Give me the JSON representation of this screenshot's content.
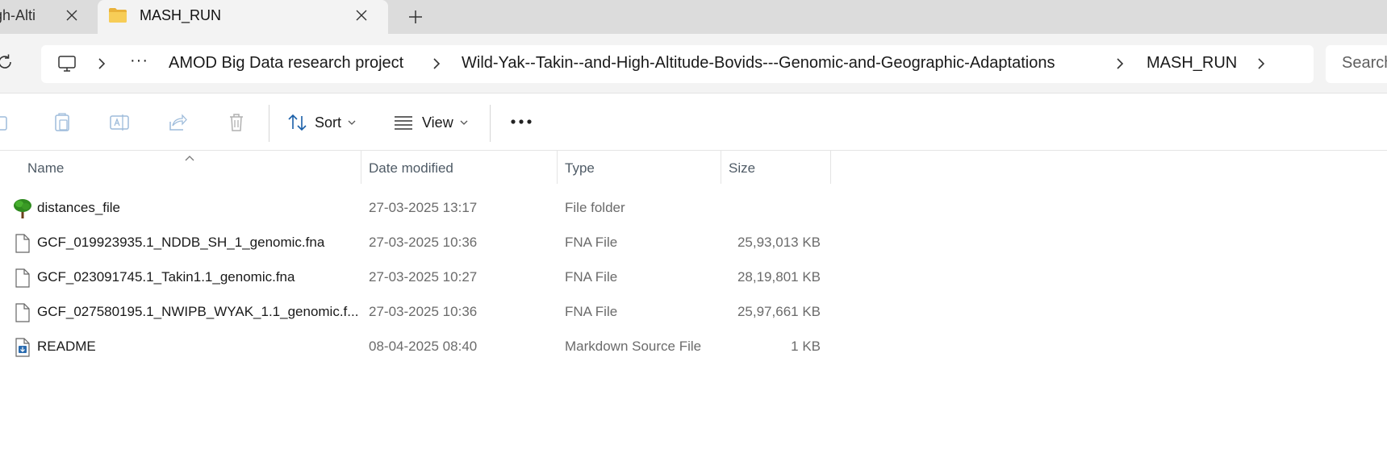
{
  "tabs": [
    {
      "title": "High-Altitude",
      "visible_text": "igh-Alti"
    },
    {
      "title": "MASH_RUN"
    }
  ],
  "breadcrumb": {
    "overflow": "···",
    "items": [
      "AMOD Big Data research project",
      "Wild-Yak--Takin--and-High-Altitude-Bovids---Genomic-and-Geographic-Adaptations",
      "MASH_RUN"
    ]
  },
  "search": {
    "placeholder": "Search"
  },
  "commandbar": {
    "sort_label": "Sort",
    "view_label": "View",
    "more_label": "•••"
  },
  "columns": {
    "name": "Name",
    "date": "Date modified",
    "type": "Type",
    "size": "Size"
  },
  "files": [
    {
      "name": "distances_file",
      "date": "27-03-2025 13:17",
      "type": "File folder",
      "size": "",
      "icon": "tree-folder-icon"
    },
    {
      "name": "GCF_019923935.1_NDDB_SH_1_genomic.fna",
      "date": "27-03-2025 10:36",
      "type": "FNA File",
      "size": "25,93,013 KB",
      "icon": "file-icon"
    },
    {
      "name": "GCF_023091745.1_Takin1.1_genomic.fna",
      "date": "27-03-2025 10:27",
      "type": "FNA File",
      "size": "28,19,801 KB",
      "icon": "file-icon"
    },
    {
      "name": "GCF_027580195.1_NWIPB_WYAK_1.1_genomic.f...",
      "date": "27-03-2025 10:36",
      "type": "FNA File",
      "size": "25,97,661 KB",
      "icon": "file-icon"
    },
    {
      "name": "README",
      "date": "08-04-2025 08:40",
      "type": "Markdown Source File",
      "size": "1 KB",
      "icon": "markdown-file-icon"
    }
  ],
  "colors": {
    "tabstrip": "#dcdcdc",
    "active_tab": "#f3f3f3",
    "folder_yellow": "#f5c84c",
    "accent_blue": "#2b6cb0"
  }
}
